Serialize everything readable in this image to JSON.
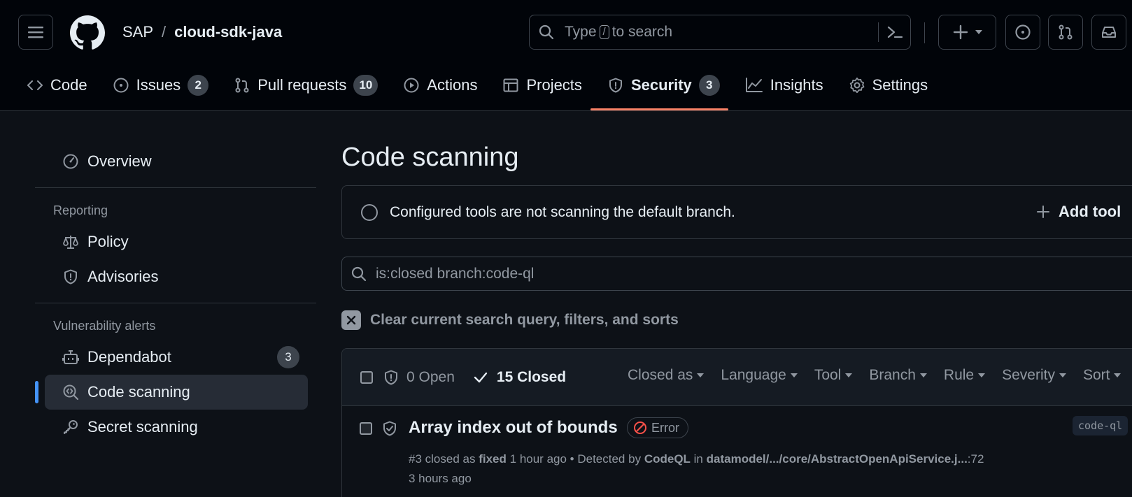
{
  "colors": {
    "accent": "#f78166",
    "active_indicator": "#4493f8",
    "error": "#f85149"
  },
  "header": {
    "owner": "SAP",
    "separator": "/",
    "repo": "cloud-sdk-java",
    "search": {
      "prefix": "Type",
      "key": "/",
      "suffix": "to search"
    }
  },
  "tabs": [
    {
      "label": "Code",
      "icon": "code-icon"
    },
    {
      "label": "Issues",
      "icon": "issue-opened-icon",
      "count": "2"
    },
    {
      "label": "Pull requests",
      "icon": "git-pull-request-icon",
      "count": "10"
    },
    {
      "label": "Actions",
      "icon": "play-icon"
    },
    {
      "label": "Projects",
      "icon": "table-icon"
    },
    {
      "label": "Security",
      "icon": "shield-icon",
      "count": "3",
      "selected": true
    },
    {
      "label": "Insights",
      "icon": "graph-icon"
    },
    {
      "label": "Settings",
      "icon": "gear-icon"
    }
  ],
  "sidebar": {
    "overview": "Overview",
    "reporting_heading": "Reporting",
    "policy": "Policy",
    "advisories": "Advisories",
    "vuln_heading": "Vulnerability alerts",
    "dependabot": "Dependabot",
    "dependabot_count": "3",
    "code_scanning": "Code scanning",
    "secret_scanning": "Secret scanning"
  },
  "main": {
    "title": "Code scanning",
    "banner_text": "Configured tools are not scanning the default branch.",
    "add_tool": "Add tool",
    "filter_value": "is:closed branch:code-ql",
    "clear_text": "Clear current search query, filters, and sorts",
    "open_label": "0 Open",
    "closed_label": "15 Closed",
    "filters": [
      "Closed as",
      "Language",
      "Tool",
      "Branch",
      "Rule",
      "Severity",
      "Sort"
    ],
    "alert": {
      "title": "Array index out of bounds",
      "severity": "Error",
      "number": "#3",
      "closed_as_text": "closed as",
      "closed_as": "fixed",
      "closed_when": "1 hour ago",
      "detected_by_text": "• Detected by",
      "tool": "CodeQL",
      "in_text": "in",
      "path": "datamodel/.../core/AbstractOpenApiService.j...",
      "line": ":72",
      "detected_when": "3 hours ago",
      "branch": "code-ql"
    }
  }
}
